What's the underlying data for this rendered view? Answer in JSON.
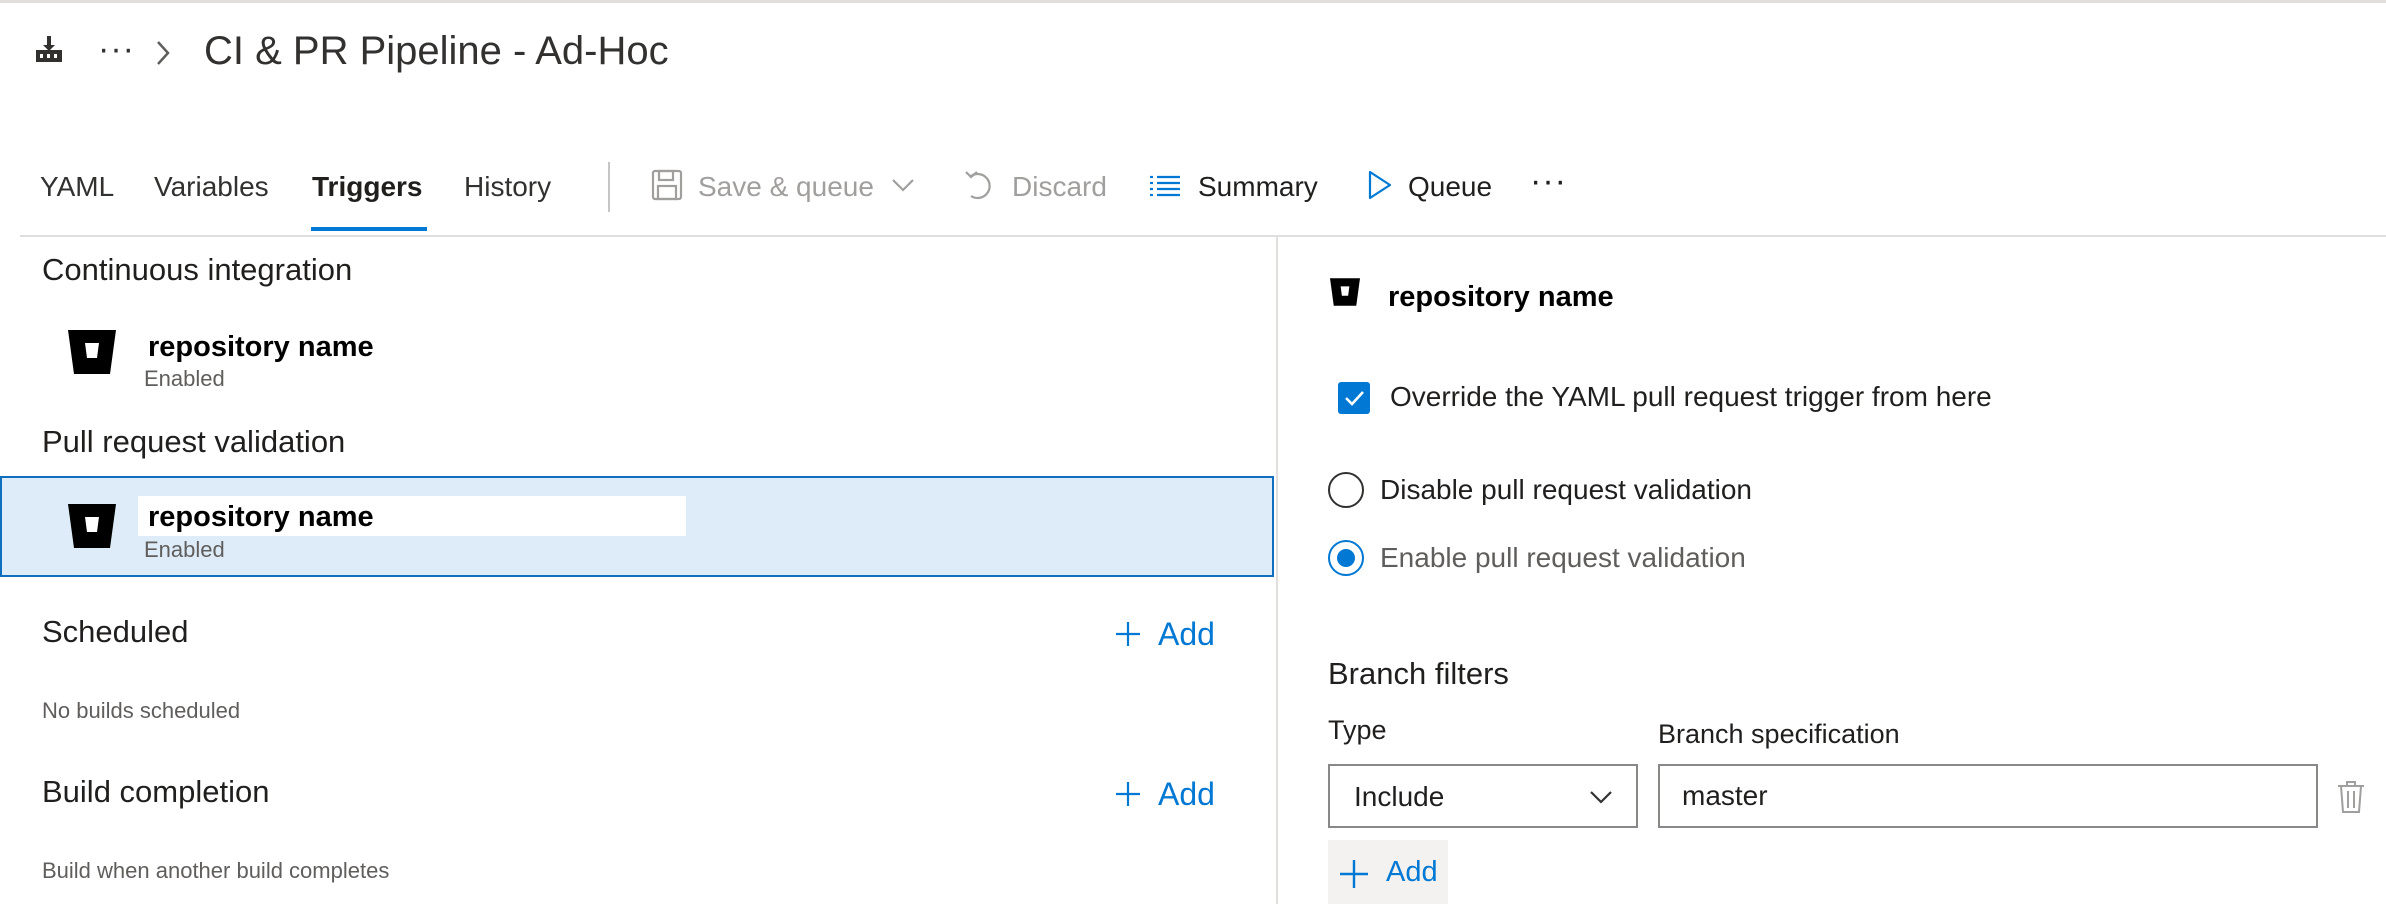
{
  "header": {
    "breadcrumb_more": "···",
    "title": "CI & PR Pipeline - Ad-Hoc"
  },
  "tabs": [
    {
      "label": "YAML"
    },
    {
      "label": "Variables"
    },
    {
      "label": "Triggers",
      "active": true
    },
    {
      "label": "History"
    }
  ],
  "toolbar": {
    "save_queue": "Save & queue",
    "discard": "Discard",
    "summary": "Summary",
    "queue": "Queue",
    "more": "···"
  },
  "left": {
    "ci": {
      "heading": "Continuous integration",
      "repo_name": "repository name",
      "status": "Enabled"
    },
    "pr": {
      "heading": "Pull request validation",
      "repo_name": "repository name",
      "status": "Enabled"
    },
    "scheduled": {
      "heading": "Scheduled",
      "add_label": "Add",
      "empty_text": "No builds scheduled"
    },
    "build_completion": {
      "heading": "Build completion",
      "add_label": "Add",
      "empty_text": "Build when another build completes"
    }
  },
  "right": {
    "repo_name": "repository name",
    "override_label": "Override the YAML pull request trigger from here",
    "override_checked": true,
    "radio_disable": "Disable pull request validation",
    "radio_enable": "Enable pull request validation",
    "selected_radio": "enable",
    "branch_filters": {
      "title": "Branch filters",
      "type_label": "Type",
      "spec_label": "Branch specification",
      "type_value": "Include",
      "spec_value": "master",
      "add_label": "Add"
    }
  },
  "colors": {
    "accent": "#0078d4",
    "selected_row_bg": "#deecf9"
  },
  "icons": {
    "pipeline": "pipeline-icon",
    "repo": "bitbucket-icon",
    "save": "save-icon",
    "discard": "undo-icon",
    "summary": "list-icon",
    "queue": "play-icon",
    "delete": "trash-icon"
  }
}
